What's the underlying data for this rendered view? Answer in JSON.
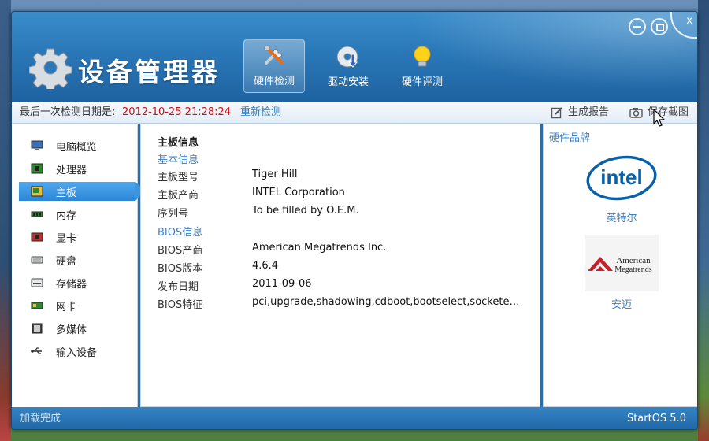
{
  "window": {
    "title": "设备管理器"
  },
  "toptabs": [
    {
      "label": "硬件检测",
      "icon": "tools-icon",
      "active": true
    },
    {
      "label": "驱动安装",
      "icon": "driver-disc-icon",
      "active": false
    },
    {
      "label": "硬件评测",
      "icon": "lightbulb-icon",
      "active": false
    }
  ],
  "controls": {
    "close_glyph": "x"
  },
  "infobar": {
    "last_label": "最后一次检测日期是:",
    "last_date": "2012-10-25 21:28:24",
    "recheck": "重新检测",
    "report": "生成报告",
    "screenshot": "保存截图"
  },
  "sidebar": {
    "items": [
      {
        "label": "电脑概览",
        "icon": "computer-icon"
      },
      {
        "label": "处理器",
        "icon": "cpu-icon"
      },
      {
        "label": "主板",
        "icon": "motherboard-icon",
        "active": true
      },
      {
        "label": "内存",
        "icon": "memory-icon"
      },
      {
        "label": "显卡",
        "icon": "graphics-card-icon"
      },
      {
        "label": "硬盘",
        "icon": "hard-disk-icon"
      },
      {
        "label": "存储器",
        "icon": "storage-icon"
      },
      {
        "label": "网卡",
        "icon": "network-card-icon"
      },
      {
        "label": "多媒体",
        "icon": "multimedia-icon"
      },
      {
        "label": "输入设备",
        "icon": "usb-icon"
      }
    ]
  },
  "main": {
    "section_title": "主板信息",
    "basic_title": "基本信息",
    "basic_rows": [
      {
        "key": "主板型号",
        "value": "Tiger Hill"
      },
      {
        "key": "主板产商",
        "value": "INTEL Corporation"
      },
      {
        "key": "序列号",
        "value": "To be filled by O.E.M."
      }
    ],
    "bios_title": "BIOS信息",
    "bios_rows": [
      {
        "key": "BIOS产商",
        "value": "American Megatrends Inc."
      },
      {
        "key": "BIOS版本",
        "value": "4.6.4"
      },
      {
        "key": "发布日期",
        "value": "2011-09-06"
      },
      {
        "key": "BIOS特征",
        "value": "pci,upgrade,shadowing,cdboot,bootselect,socketedrom"
      }
    ]
  },
  "brands": {
    "title": "硬件品牌",
    "intel_logo_text": "intel",
    "intel_name": "英特尔",
    "ami_logo_text": [
      "American",
      "Megatrends"
    ],
    "ami_name": "安迈"
  },
  "status": {
    "left": "加载完成",
    "right": "StartOS 5.0"
  },
  "colors": {
    "accent": "#2d86d6",
    "date_red": "#d01010",
    "link_blue": "#3f7fc0",
    "header_blue": "#2a78b8"
  }
}
